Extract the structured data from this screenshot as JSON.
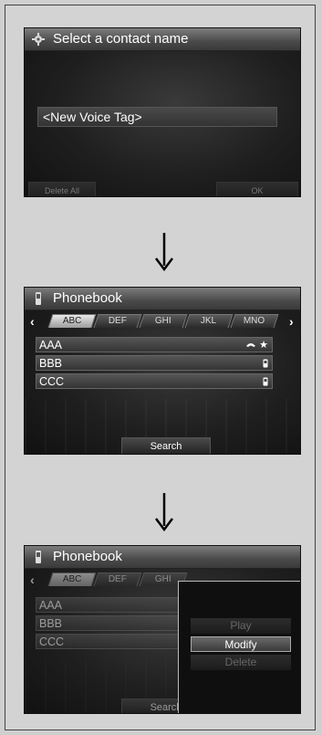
{
  "screen1": {
    "title": "Select a contact name",
    "voice_tag_item": "<New Voice Tag>",
    "left_button": "Delete All",
    "right_button": "OK"
  },
  "screen2": {
    "title": "Phonebook",
    "tabs": [
      "ABC",
      "DEF",
      "GHI",
      "JKL",
      "MNO"
    ],
    "active_tab": "ABC",
    "contacts": [
      {
        "name": "AAA",
        "icons": [
          "phone-handset-icon",
          "star-icon"
        ]
      },
      {
        "name": "BBB",
        "icons": [
          "mobile-phone-icon"
        ]
      },
      {
        "name": "CCC",
        "icons": [
          "mobile-phone-icon"
        ]
      }
    ],
    "search_button": "Search"
  },
  "screen3": {
    "title": "Phonebook",
    "tabs": [
      "ABC",
      "DEF",
      "GHI"
    ],
    "contacts": [
      "AAA",
      "BBB",
      "CCC"
    ],
    "search_button": "Search",
    "menu": {
      "items": [
        "Play",
        "Modify",
        "Delete"
      ],
      "selected": "Modify"
    }
  }
}
